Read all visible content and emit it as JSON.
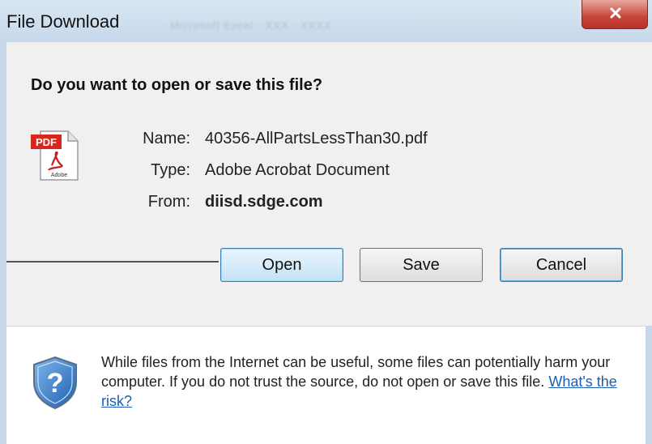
{
  "window": {
    "title": "File Download",
    "background_title": "- Microsoft Excel - XXX - XXXX"
  },
  "prompt": {
    "question": "Do you want to open or save this file?"
  },
  "file": {
    "name_label": "Name:",
    "name": "40356-AllPartsLessThan30.pdf",
    "type_label": "Type:",
    "type": "Adobe Acrobat Document",
    "from_label": "From:",
    "from": "diisd.sdge.com",
    "icon": "pdf-icon",
    "icon_text": "PDF",
    "icon_brand": "Adobe"
  },
  "buttons": {
    "open": "Open",
    "save": "Save",
    "cancel": "Cancel"
  },
  "warning": {
    "text": "While files from the Internet can be useful, some files can potentially harm your computer. If you do not trust the source, do not open or save this file.",
    "link": "What's the risk?",
    "icon": "shield-question-icon"
  },
  "colors": {
    "accent": "#1a5fb4",
    "close": "#c8453a"
  }
}
